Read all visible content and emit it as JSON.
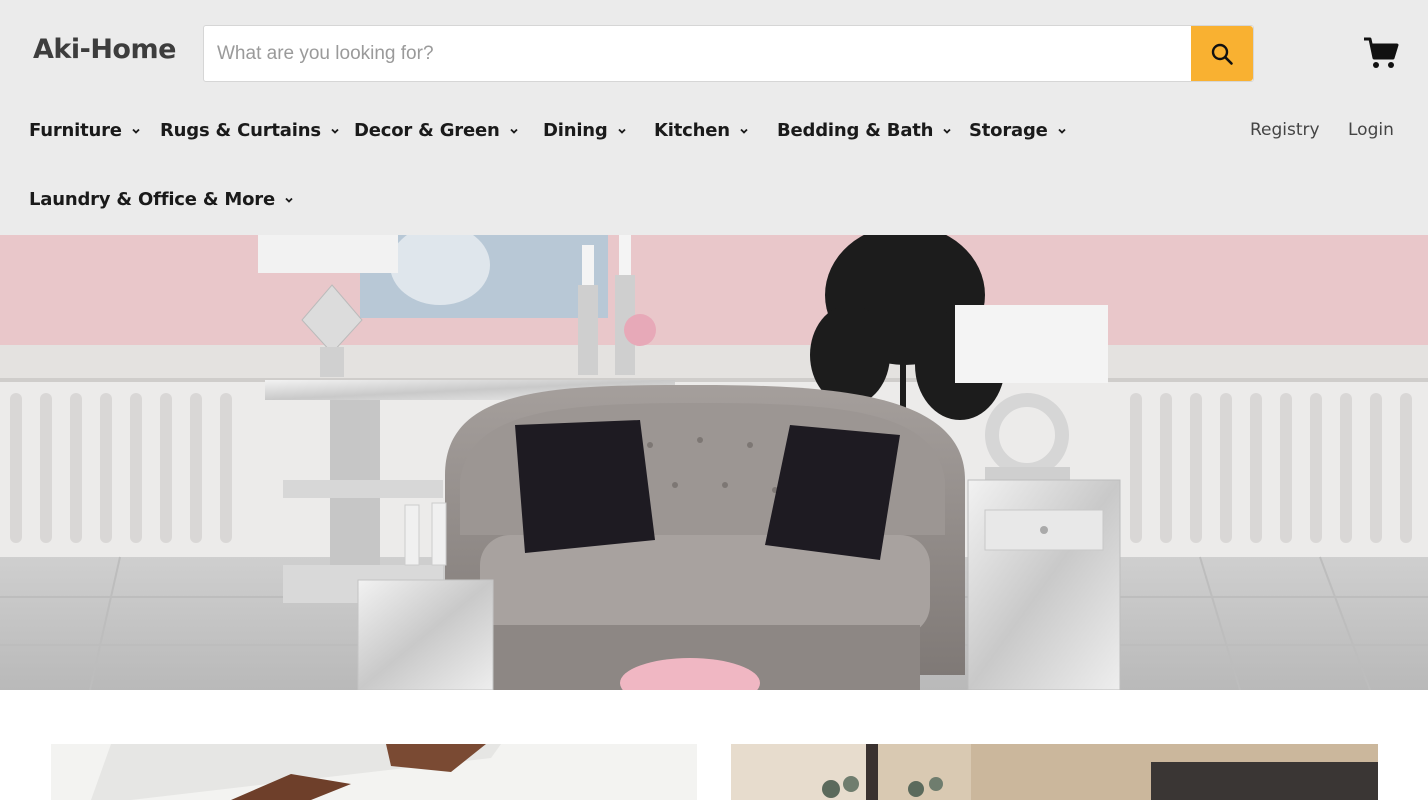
{
  "brand": {
    "logo_text": "Aki-Home"
  },
  "search": {
    "placeholder": "What are you looking for?",
    "value": "",
    "button_icon": "search-icon",
    "button_color": "#f9b131"
  },
  "cart": {
    "icon": "cart-icon"
  },
  "nav": {
    "items": [
      {
        "label": "Furniture"
      },
      {
        "label": "Rugs & Curtains"
      },
      {
        "label": "Decor & Green"
      },
      {
        "label": "Dining"
      },
      {
        "label": "Kitchen"
      },
      {
        "label": "Bedding & Bath"
      },
      {
        "label": "Storage"
      },
      {
        "label": "Laundry & Office & More"
      }
    ],
    "chevron_icon": "chevron-down-icon"
  },
  "utility": {
    "registry_label": "Registry",
    "login_label": "Login"
  },
  "hero": {
    "image": "living-room-banner",
    "wall_color": "#e9c7ca"
  },
  "tiles": [
    {
      "image": "dining-room-photo"
    },
    {
      "image": "bedroom-dresser-photo"
    }
  ]
}
